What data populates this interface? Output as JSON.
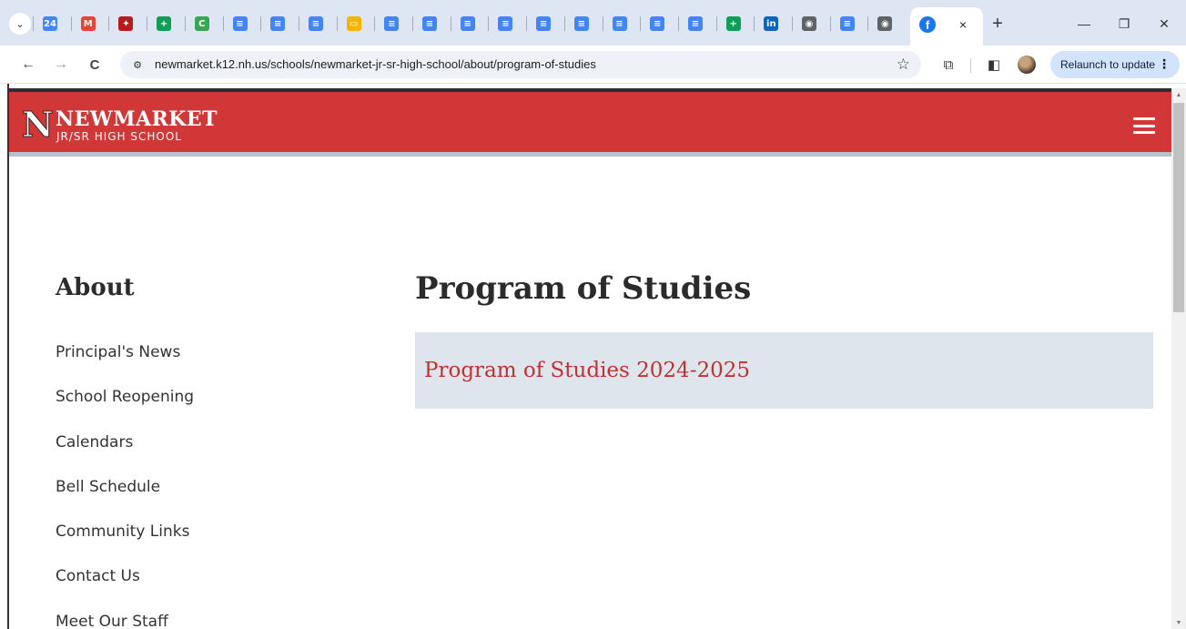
{
  "browser": {
    "tab_search_icon": "chevron-down-icon",
    "pinned_tabs": [
      {
        "name": "google-calendar-tab",
        "icon": "calendar-icon",
        "glyph": "24",
        "color": "#4285f4"
      },
      {
        "name": "gmail-tab",
        "icon": "gmail-icon",
        "glyph": "M",
        "color": "#ea4335"
      },
      {
        "name": "app-tab",
        "icon": "bird-icon",
        "glyph": "✦",
        "color": "#b71c1c"
      },
      {
        "name": "sheets-tab",
        "icon": "sheets-icon",
        "glyph": "+",
        "color": "#0f9d58"
      },
      {
        "name": "classroom-tab",
        "icon": "classroom-icon",
        "glyph": "C",
        "color": "#34a853"
      },
      {
        "name": "docs-tab-1",
        "icon": "docs-icon",
        "glyph": "≡",
        "color": "#4285f4"
      },
      {
        "name": "docs-tab-2",
        "icon": "docs-icon",
        "glyph": "≡",
        "color": "#4285f4"
      },
      {
        "name": "docs-tab-3",
        "icon": "docs-icon",
        "glyph": "≡",
        "color": "#4285f4"
      },
      {
        "name": "slides-tab",
        "icon": "slides-icon",
        "glyph": "▭",
        "color": "#f4b400"
      },
      {
        "name": "docs-tab-4",
        "icon": "docs-icon",
        "glyph": "≡",
        "color": "#4285f4"
      },
      {
        "name": "docs-tab-5",
        "icon": "docs-icon",
        "glyph": "≡",
        "color": "#4285f4"
      },
      {
        "name": "docs-tab-6",
        "icon": "docs-icon",
        "glyph": "≡",
        "color": "#4285f4"
      },
      {
        "name": "docs-tab-7",
        "icon": "docs-icon",
        "glyph": "≡",
        "color": "#4285f4"
      },
      {
        "name": "docs-tab-8",
        "icon": "docs-icon",
        "glyph": "≡",
        "color": "#4285f4"
      },
      {
        "name": "docs-tab-9",
        "icon": "docs-icon",
        "glyph": "≡",
        "color": "#4285f4"
      },
      {
        "name": "docs-tab-10",
        "icon": "docs-icon",
        "glyph": "≡",
        "color": "#4285f4"
      },
      {
        "name": "docs-tab-11",
        "icon": "docs-icon",
        "glyph": "≡",
        "color": "#4285f4"
      },
      {
        "name": "docs-tab-12",
        "icon": "docs-icon",
        "glyph": "≡",
        "color": "#4285f4"
      },
      {
        "name": "sheets-tab-2",
        "icon": "sheets-icon",
        "glyph": "+",
        "color": "#0f9d58"
      },
      {
        "name": "linkedin-tab",
        "icon": "linkedin-icon",
        "glyph": "in",
        "color": "#0a66c2"
      },
      {
        "name": "globe-tab-1",
        "icon": "globe-icon",
        "glyph": "◉",
        "color": "#5f6368"
      },
      {
        "name": "docs-tab-13",
        "icon": "docs-icon",
        "glyph": "≡",
        "color": "#4285f4"
      },
      {
        "name": "globe-tab-2",
        "icon": "globe-icon",
        "glyph": "◉",
        "color": "#5f6368"
      }
    ],
    "active_tab_icon": "facebook-icon",
    "active_tab_close": "×",
    "new_tab": "+",
    "window_controls": {
      "minimize": "—",
      "restore": "❐",
      "close": "✕"
    },
    "back": "←",
    "forward": "→",
    "reload": "C",
    "site_info_icon": "site-settings-icon",
    "url": "newmarket.k12.nh.us/schools/newmarket-jr-sr-high-school/about/program-of-studies",
    "bookmark_star": "☆",
    "relaunch_label": "Relaunch to update",
    "menu_dots": "⋮"
  },
  "site": {
    "logo_letter": "N",
    "name": "NEWMARKET",
    "subtitle": "JR/SR HIGH SCHOOL",
    "brand_color": "#d23737"
  },
  "sidebar": {
    "heading": "About",
    "items": [
      {
        "label": "Principal's News"
      },
      {
        "label": "School Reopening"
      },
      {
        "label": "Calendars"
      },
      {
        "label": "Bell Schedule"
      },
      {
        "label": "Community Links"
      },
      {
        "label": "Contact Us"
      },
      {
        "label": "Meet Our Staff"
      }
    ]
  },
  "main": {
    "title": "Program of Studies",
    "document_link": "Program of Studies 2024-2025"
  }
}
